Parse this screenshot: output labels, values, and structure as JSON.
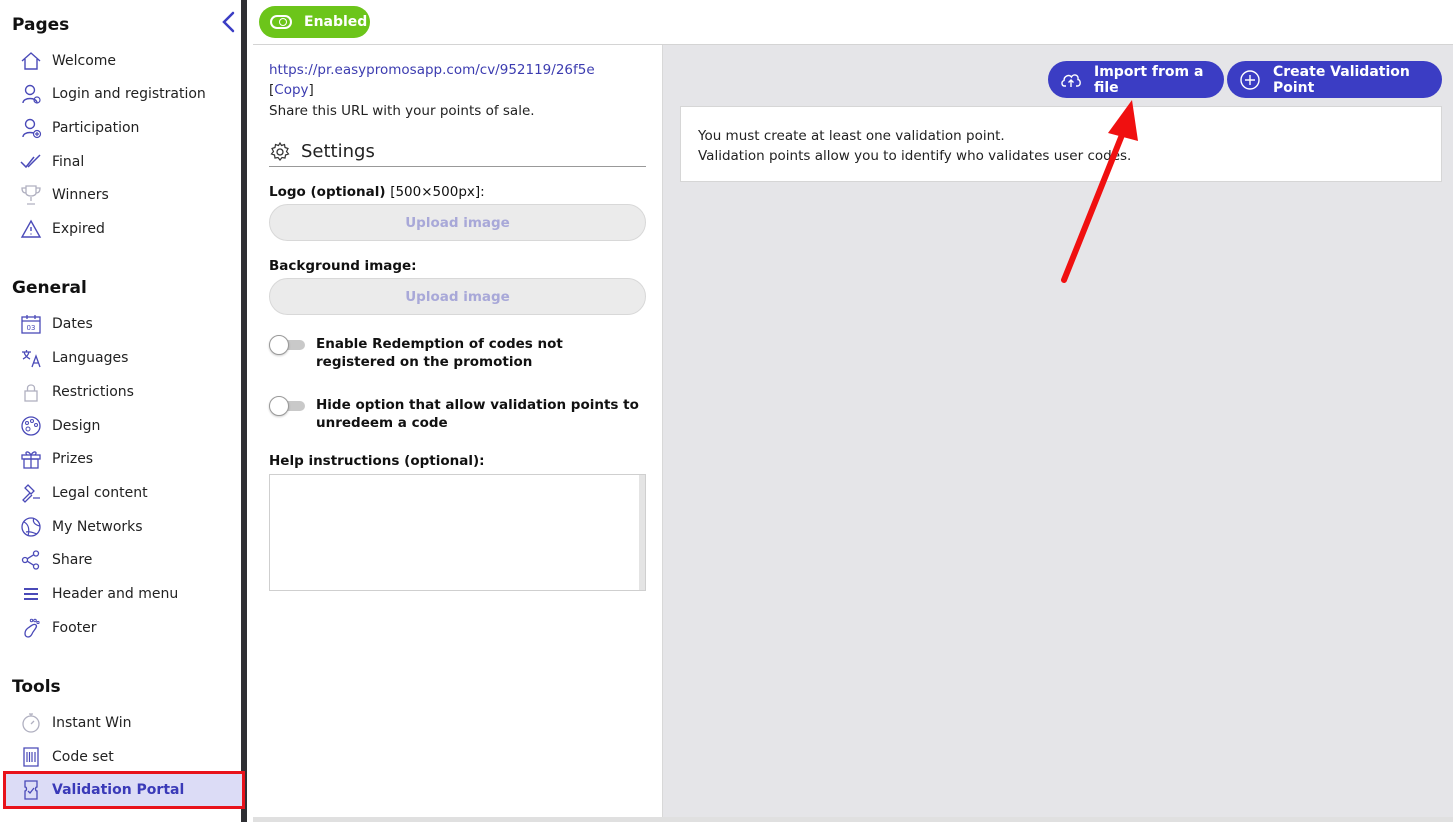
{
  "sidebar": {
    "sections": [
      {
        "title": "Pages",
        "items": [
          {
            "label": "Welcome",
            "icon": "home-icon"
          },
          {
            "label": "Login and registration",
            "icon": "user-icon"
          },
          {
            "label": "Participation",
            "icon": "user-plus-icon"
          },
          {
            "label": "Final",
            "icon": "check-double-icon"
          },
          {
            "label": "Winners",
            "icon": "trophy-icon"
          },
          {
            "label": "Expired",
            "icon": "warning-icon"
          }
        ]
      },
      {
        "title": "General",
        "items": [
          {
            "label": "Dates",
            "icon": "calendar-icon"
          },
          {
            "label": "Languages",
            "icon": "translate-icon"
          },
          {
            "label": "Restrictions",
            "icon": "lock-icon"
          },
          {
            "label": "Design",
            "icon": "palette-icon"
          },
          {
            "label": "Prizes",
            "icon": "gift-icon"
          },
          {
            "label": "Legal content",
            "icon": "gavel-icon"
          },
          {
            "label": "My Networks",
            "icon": "globe-icon"
          },
          {
            "label": "Share",
            "icon": "share-icon"
          },
          {
            "label": "Header and menu",
            "icon": "menu-icon"
          },
          {
            "label": "Footer",
            "icon": "footprint-icon"
          }
        ]
      },
      {
        "title": "Tools",
        "items": [
          {
            "label": "Instant Win",
            "icon": "stopwatch-icon"
          },
          {
            "label": "Code set",
            "icon": "barcode-icon"
          },
          {
            "label": "Validation Portal",
            "icon": "ticket-check-icon",
            "active": true
          }
        ]
      }
    ]
  },
  "topbar": {
    "status_label": "Enabled",
    "status_color": "#6cc51a"
  },
  "panel": {
    "url": "https://pr.easypromosapp.com/cv/952119/26f5e",
    "copy_open": "[",
    "copy_label": "Copy",
    "copy_close": "]",
    "share_text": "Share this URL with your points of sale.",
    "settings_title": "Settings",
    "logo_label": "Logo (optional)",
    "logo_size": "[500×500px]:",
    "upload_label": "Upload image",
    "background_label": "Background image:",
    "toggle1_label": "Enable Redemption of codes not registered on the promotion",
    "toggle2_label": "Hide option that allow validation points to unredeem a code",
    "help_label": "Help instructions (optional):",
    "help_value": ""
  },
  "main": {
    "import_label": "Import from a file",
    "create_label": "Create Validation Point",
    "info_line1": "You must create at least one validation point.",
    "info_line2": "Validation points allow you to identify who validates user codes.",
    "accent_color": "#3b3dc4"
  }
}
